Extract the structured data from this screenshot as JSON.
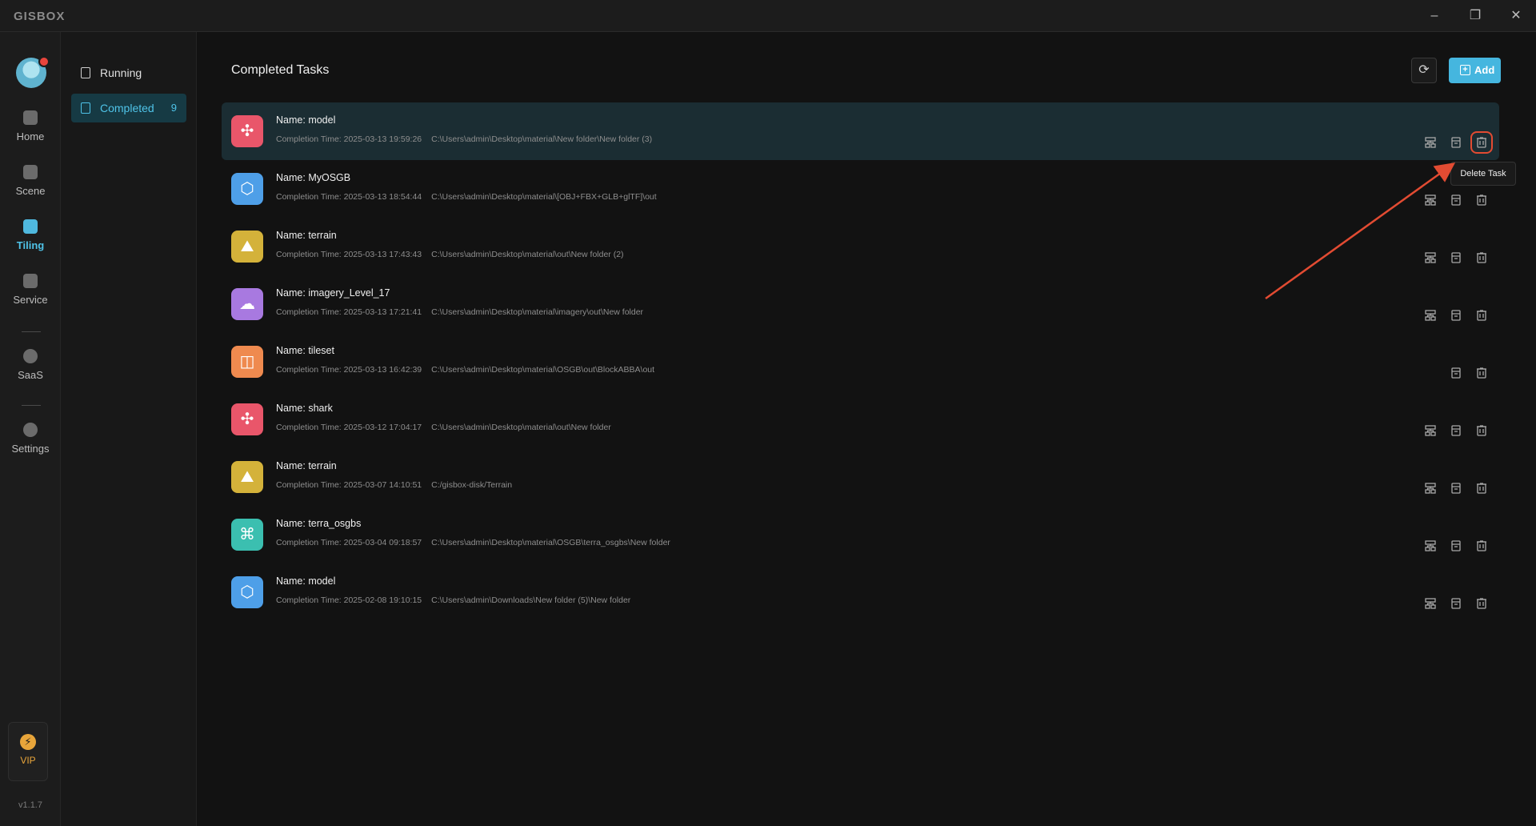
{
  "app": {
    "logo": "GISBOX"
  },
  "window": {
    "minimize": "–",
    "maximize": "❐",
    "close": "✕"
  },
  "rail": {
    "items": [
      {
        "label": "Home",
        "icon": "home-icon"
      },
      {
        "label": "Scene",
        "icon": "cube-icon"
      },
      {
        "label": "Tiling",
        "icon": "tiling-icon",
        "active": true
      },
      {
        "label": "Service",
        "icon": "service-icon"
      },
      {
        "label": "SaaS",
        "icon": "lock-icon"
      },
      {
        "label": "Settings",
        "icon": "gear-icon"
      }
    ],
    "vip": {
      "label": "VIP",
      "glyph": "⚡"
    },
    "version": "v1.1.7"
  },
  "subnav": {
    "running": {
      "label": "Running"
    },
    "completed": {
      "label": "Completed",
      "count": "9"
    }
  },
  "main": {
    "title": "Completed Tasks",
    "refresh_glyph": "⟳",
    "add_label": "Add",
    "tooltip": "Delete Task"
  },
  "tasks": [
    {
      "name_label": "Name:",
      "name": "model",
      "meta_label": "Completion Time:",
      "time": "2025-03-13 19:59:26",
      "path": "C:\\Users\\admin\\Desktop\\material\\New folder\\New folder (3)",
      "color": "#e9566a",
      "glyph": "✣"
    },
    {
      "name_label": "Name:",
      "name": "MyOSGB",
      "meta_label": "Completion Time:",
      "time": "2025-03-13 18:54:44",
      "path": "C:\\Users\\admin\\Desktop\\material\\[OBJ+FBX+GLB+glTF]\\out",
      "color": "#4e9fe8",
      "glyph": "⬡"
    },
    {
      "name_label": "Name:",
      "name": "terrain",
      "meta_label": "Completion Time:",
      "time": "2025-03-13 17:43:43",
      "path": "C:\\Users\\admin\\Desktop\\material\\out\\New folder (2)",
      "color": "#d4b23a",
      "glyph": "⛰"
    },
    {
      "name_label": "Name:",
      "name": "imagery_Level_17",
      "meta_label": "Completion Time:",
      "time": "2025-03-13 17:21:41",
      "path": "C:\\Users\\admin\\Desktop\\material\\imagery\\out\\New folder",
      "color": "#a879e0",
      "glyph": "☁"
    },
    {
      "name_label": "Name:",
      "name": "tileset",
      "meta_label": "Completion Time:",
      "time": "2025-03-13 16:42:39",
      "path": "C:\\Users\\admin\\Desktop\\material\\OSGB\\out\\BlockABBA\\out",
      "color": "#ef8a4f",
      "glyph": "◫"
    },
    {
      "name_label": "Name:",
      "name": "shark",
      "meta_label": "Completion Time:",
      "time": "2025-03-12 17:04:17",
      "path": "C:\\Users\\admin\\Desktop\\material\\out\\New folder",
      "color": "#e9566a",
      "glyph": "✣"
    },
    {
      "name_label": "Name:",
      "name": "terrain",
      "meta_label": "Completion Time:",
      "time": "2025-03-07 14:10:51",
      "path": "C:/gisbox-disk/Terrain",
      "color": "#d4b23a",
      "glyph": "⛰"
    },
    {
      "name_label": "Name:",
      "name": "terra_osgbs",
      "meta_label": "Completion Time:",
      "time": "2025-03-04 09:18:57",
      "path": "C:\\Users\\admin\\Desktop\\material\\OSGB\\terra_osgbs\\New folder",
      "color": "#3bbfb0",
      "glyph": "⌘"
    },
    {
      "name_label": "Name:",
      "name": "model",
      "meta_label": "Completion Time:",
      "time": "2025-02-08 19:10:15",
      "path": "C:\\Users\\admin\\Downloads\\New folder (5)\\New folder",
      "color": "#4e9fe8",
      "glyph": "⬡"
    }
  ]
}
